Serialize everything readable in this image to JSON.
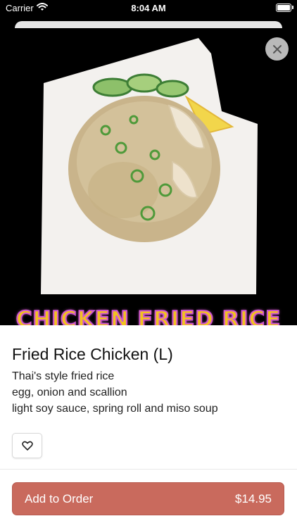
{
  "status_bar": {
    "carrier": "Carrier",
    "time": "8:04 AM"
  },
  "hero": {
    "banner_text": "CHICKEN FRIED RICE"
  },
  "item": {
    "title": "Fried Rice Chicken (L)",
    "description_lines": [
      "Thai's style fried rice",
      "egg, onion and scallion",
      "light soy sauce, spring roll and miso soup"
    ]
  },
  "actions": {
    "add_label": "Add to Order",
    "price": "$14.95"
  },
  "colors": {
    "order_button": "#c96a5d",
    "banner_fill": "#f2c21f",
    "banner_outline": "#cf57d0"
  },
  "icons": {
    "close": "close-icon",
    "favorite": "heart-icon",
    "wifi": "wifi-icon",
    "battery": "battery-icon"
  }
}
